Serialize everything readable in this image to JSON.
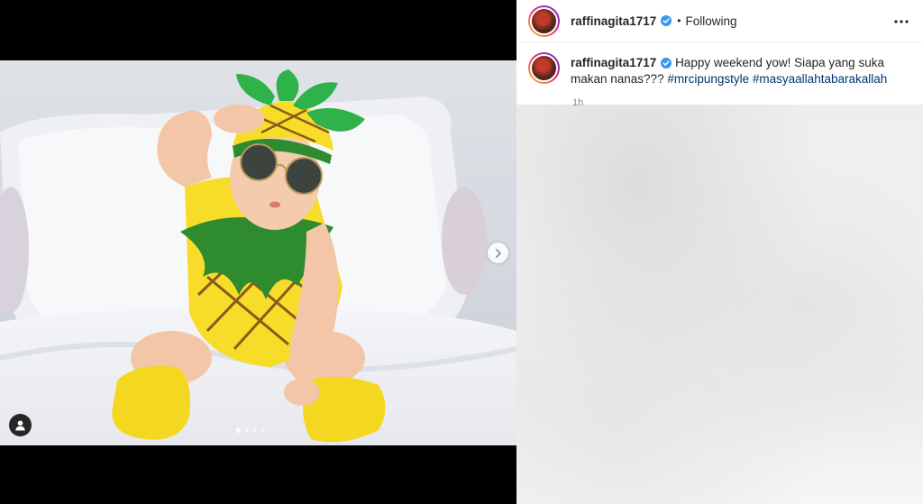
{
  "post": {
    "username": "raffinagita1717",
    "follow_status": "Following",
    "separator": "•",
    "timestamp": "1h"
  },
  "caption": {
    "username": "raffinagita1717",
    "text": "Happy weekend yow! Siapa yang suka makan nanas???",
    "hashtags": [
      "#mrcipungstyle",
      "#masyaallahtabarakallah"
    ]
  },
  "carousel": {
    "slide_count": 4,
    "active_index": 0
  },
  "icons": {
    "verified": "verified-badge-icon",
    "more": "more-options-icon",
    "next": "chevron-right-icon",
    "tag": "user-tag-icon"
  },
  "colors": {
    "verified": "#3897f0",
    "hashtag": "#00376b",
    "text": "#262626"
  }
}
